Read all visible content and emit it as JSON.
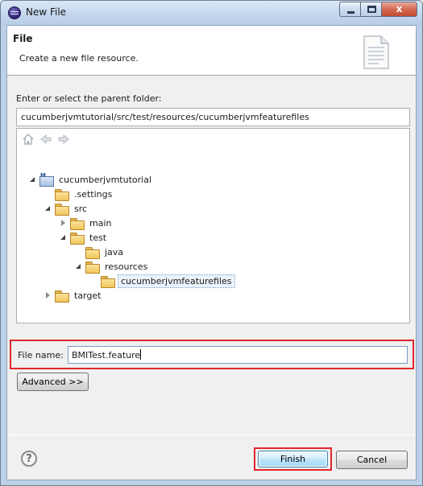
{
  "window": {
    "title": "New File",
    "minimize_label": "",
    "maximize_label": "",
    "close_label": "x"
  },
  "header": {
    "title": "File",
    "description": "Create a new file resource."
  },
  "folder": {
    "label": "Enter or select the parent folder:",
    "path": "cucumberjvmtutorial/src/test/resources/cucumberjvmfeaturefiles"
  },
  "tree": {
    "nav_icons": [
      "home-icon",
      "back-icon",
      "forward-icon"
    ],
    "items": [
      {
        "label": "cucumberjvmtutorial",
        "icon": "project-icon",
        "state": "expanded"
      },
      {
        "label": ".settings",
        "icon": "folder-icon",
        "state": "leaf"
      },
      {
        "label": "src",
        "icon": "folder-icon",
        "state": "expanded"
      },
      {
        "label": "main",
        "icon": "folder-icon",
        "state": "collapsed"
      },
      {
        "label": "test",
        "icon": "folder-icon",
        "state": "expanded"
      },
      {
        "label": "java",
        "icon": "folder-icon",
        "state": "leaf"
      },
      {
        "label": "resources",
        "icon": "folder-icon",
        "state": "expanded"
      },
      {
        "label": "cucumberjvmfeaturefiles",
        "icon": "folder-icon",
        "state": "selected"
      },
      {
        "label": "target",
        "icon": "folder-icon",
        "state": "collapsed"
      }
    ]
  },
  "file_name": {
    "label": "File name:",
    "value": "BMITest.feature"
  },
  "buttons": {
    "advanced": "Advanced >>",
    "help": "?",
    "finish": "Finish",
    "cancel": "Cancel"
  },
  "colors": {
    "highlight": "#e0262b",
    "title_bar": "#c4d7ee",
    "dialog_bg": "#f0f0f0"
  }
}
